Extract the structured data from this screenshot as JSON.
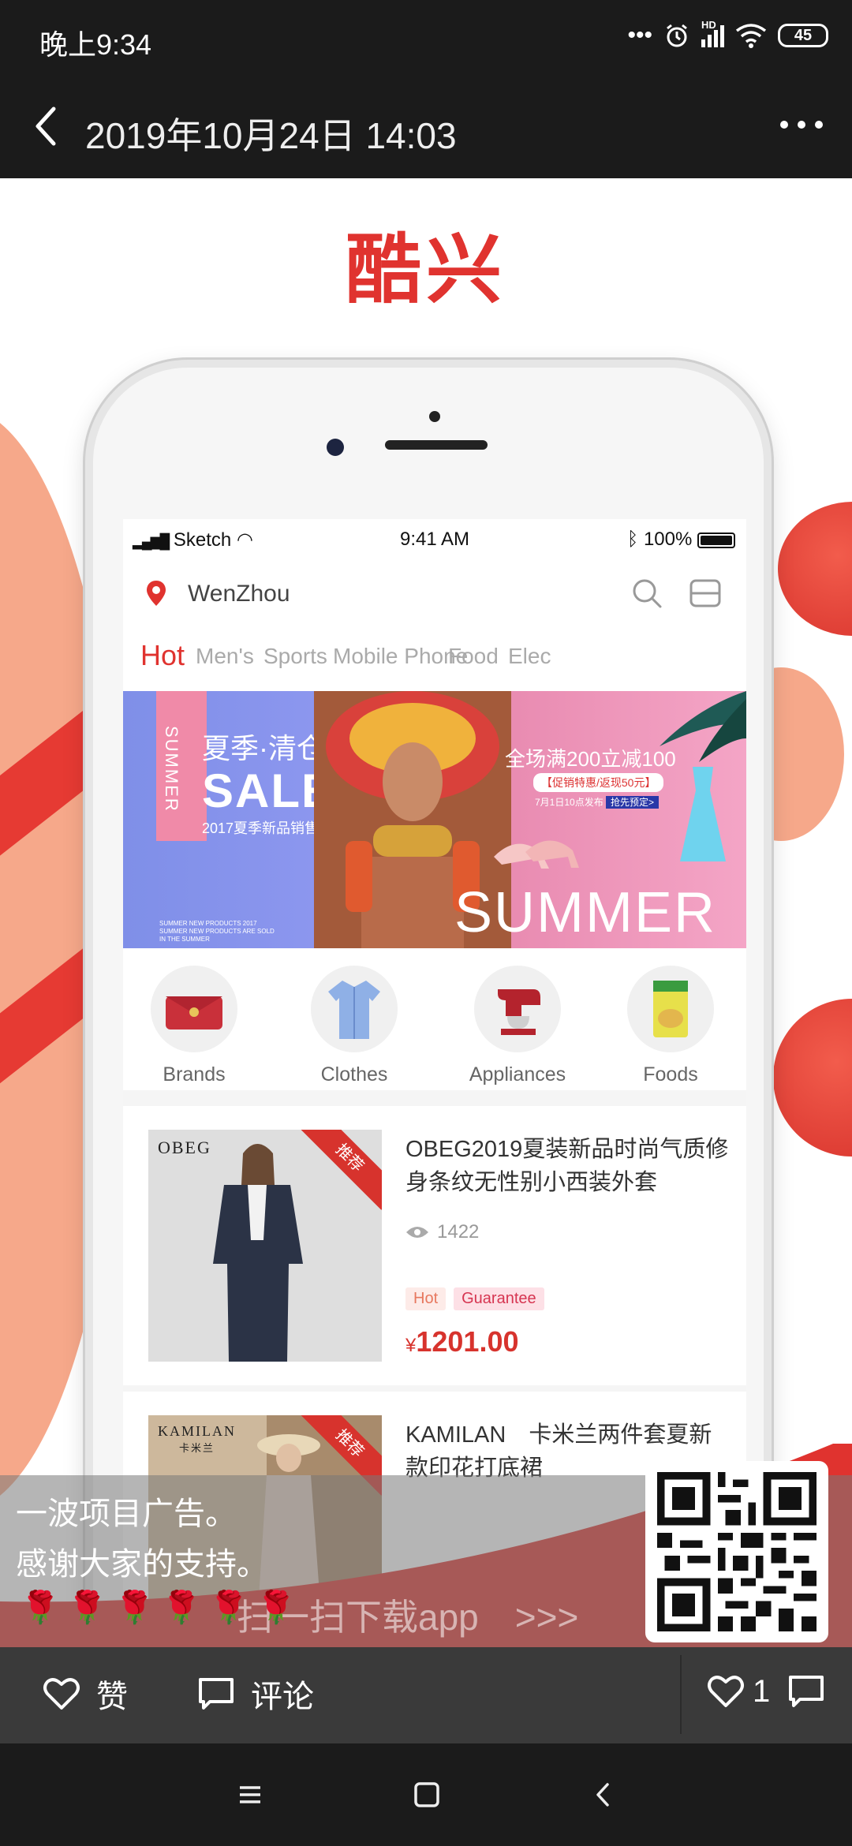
{
  "status_bar": {
    "time": "晚上9:34",
    "hd": "HD",
    "battery": "45"
  },
  "title_bar": {
    "title": "2019年10月24日 14:03"
  },
  "post": {
    "brand_title": "酷兴",
    "mock_phone": {
      "ios_status": {
        "carrier": "Sketch",
        "time": "9:41 AM",
        "battery": "100%"
      },
      "location": "WenZhou",
      "tabs": [
        "Hot",
        "Men's",
        "Sports",
        "Mobile Phone",
        "Food",
        "Elec"
      ],
      "banner": {
        "vertical_text": "SUMMER",
        "headline_cn": "夏季·清仓",
        "sale": "SALE",
        "sub_cn": "2017夏季新品销售",
        "small_text": "SUMMER NEW PRODUCTS 2017 SUMMER NEW PRODUCTS ARE SOLD IN THE SUMMER",
        "promo": "全场满200立减100",
        "promo_tag": "【促销特惠/返现50元】",
        "promo_date": "7月1日10点发布",
        "promo_btn": "抢先预定>",
        "summer_big": "SUMMER"
      },
      "categories": [
        {
          "label": "Brands",
          "icon": "handbag-icon"
        },
        {
          "label": "Clothes",
          "icon": "shirt-icon"
        },
        {
          "label": "Appliances",
          "icon": "mixer-icon"
        },
        {
          "label": "Foods",
          "icon": "snack-bag-icon"
        }
      ],
      "products": [
        {
          "brand": "OBEG",
          "corner_tag": "推荐",
          "title": "OBEG2019夏装新品时尚气质修身条纹无性别小西装外套",
          "views": "1422",
          "badges": [
            "Hot",
            "Guarantee"
          ],
          "currency": "¥",
          "price": "1201.00"
        },
        {
          "brand": "KAMILAN",
          "brand_cn": "卡米兰",
          "corner_tag": "推荐",
          "title": "KAMILAN　卡米兰两件套夏新款印花打底裙"
        }
      ]
    },
    "caption": {
      "line1": "一波项目广告。",
      "line2": "感谢大家的支持。",
      "roses": "🌹🌹🌹🌹🌹🌹",
      "scan_text": "扫一扫下载app　>>>"
    }
  },
  "action_bar": {
    "like_label": "赞",
    "comment_label": "评论",
    "like_count": "1"
  },
  "colors": {
    "brand_red": "#e0332f",
    "dark_bg": "#1b1b1b",
    "action_bg": "#3a3a3a"
  }
}
